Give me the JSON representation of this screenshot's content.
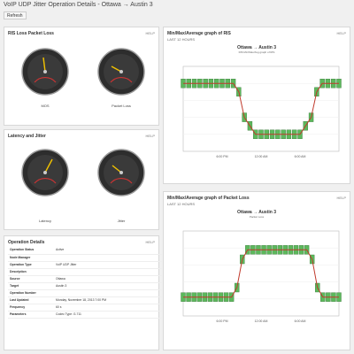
{
  "page": {
    "title": "VoIP UDP Jitter Operation Details - Ottawa → Austin 3",
    "toolbar_label": "Refresh"
  },
  "panels": {
    "gauges_top": {
      "title": "RIS Loss Packet Loss",
      "help": "HELP"
    },
    "gauges_bottom": {
      "title": "Latency and Jitter",
      "help": "HELP"
    },
    "chart_top": {
      "title": "Min/Max/Average graph of RIS",
      "sub": "LAST 12 HOURS",
      "help": "HELP",
      "name": "Ottawa → Austin 3",
      "meta": "RIS Min/Max/Avg graph of RIS"
    },
    "chart_bottom": {
      "title": "Min/Max/Average graph of Packet Loss",
      "sub": "LAST 12 HOURS",
      "help": "HELP",
      "name": "Ottawa → Austin 3",
      "meta": "Packet Loss"
    },
    "details": {
      "title": "Operation Details",
      "help": "HELP"
    }
  },
  "gauges": [
    {
      "label": "MOS",
      "value": 0.55
    },
    {
      "label": "Packet Loss",
      "value": 0.15
    },
    {
      "label": "Latency",
      "value": 0.62
    },
    {
      "label": "Jitter",
      "value": 0.18
    }
  ],
  "chart_data": [
    {
      "type": "line",
      "x": [
        "6:00 PM",
        "12:00 AM",
        "6:00 AM"
      ],
      "series": [
        {
          "values": [
            5,
            5,
            5,
            5,
            5,
            5,
            5,
            5,
            5,
            5,
            4,
            1,
            0,
            -1,
            -1,
            -1,
            -1,
            -1,
            -1,
            -1,
            -1,
            -1,
            0,
            1,
            4,
            5,
            5,
            5,
            5
          ]
        }
      ]
    },
    {
      "type": "line",
      "x": [
        "6:00 PM",
        "12:00 AM",
        "6:00 AM"
      ],
      "series": [
        {
          "values": [
            1,
            1,
            1,
            1,
            1,
            1,
            1,
            1,
            1,
            1,
            2,
            5,
            6,
            6,
            6,
            6,
            6,
            6,
            6,
            6,
            6,
            6,
            6,
            6,
            5,
            2,
            1,
            1,
            1,
            1
          ]
        }
      ]
    }
  ],
  "details": [
    {
      "key": "Operation Status",
      "value": "Active"
    },
    {
      "key": "Node Manager",
      "value": ""
    },
    {
      "key": "Operation Type",
      "value": "VoIP UDP Jitter"
    },
    {
      "key": "Description",
      "value": ""
    },
    {
      "key": "Source",
      "value": "Ottawa"
    },
    {
      "key": "Target",
      "value": "Austin 3"
    },
    {
      "key": "Operation Number",
      "value": ""
    },
    {
      "key": "Last Updated",
      "value": "Monday, November 18, 2013 7:00 PM"
    },
    {
      "key": "Frequency",
      "value": "60 s"
    },
    {
      "key": "Parameters",
      "value": "Codec Type: G.711"
    }
  ]
}
